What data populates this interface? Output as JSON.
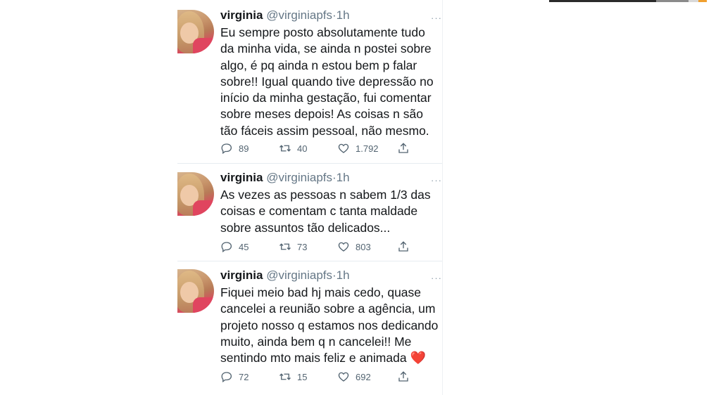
{
  "tweets": [
    {
      "name": "virginia",
      "handle": "@virginiapfs",
      "dot": "·",
      "time": "1h",
      "more": "···",
      "text": "Eu sempre posto absolutamente tudo\nda minha vida, se ainda n postei sobre\nalgo, é pq ainda n estou bem p falar\nsobre!! Igual quando tive depressão no\ninício da minha gestação, fui comentar\nsobre meses depois! As coisas n são\ntão fáceis assim pessoal, não mesmo.",
      "replies": "89",
      "retweets": "40",
      "likes": "1.792"
    },
    {
      "name": "virginia",
      "handle": "@virginiapfs",
      "dot": "·",
      "time": "1h",
      "more": "···",
      "text": "As vezes as pessoas n sabem 1/3 das\ncoisas e comentam c tanta maldade\nsobre assuntos tão delicados...",
      "replies": "45",
      "retweets": "73",
      "likes": "803"
    },
    {
      "name": "virginia",
      "handle": "@virginiapfs",
      "dot": "·",
      "time": "1h",
      "more": "···",
      "text": "Fiquei meio bad hj mais cedo, quase\ncancelei a reunião sobre a agência, um\nprojeto nosso q estamos nos dedicando\nmuito, ainda bem q n cancelei!! Me\nsentindo mto mais feliz e animada",
      "emoji": "❤️",
      "replies": "72",
      "retweets": "15",
      "likes": "692"
    }
  ],
  "icons": {
    "reply": "reply-icon",
    "retweet": "retweet-icon",
    "like": "heart-icon",
    "share": "share-icon"
  },
  "colors": {
    "text": "#14171a",
    "secondary": "#657786",
    "icon": "#536471",
    "divider": "#e6ecf0"
  }
}
